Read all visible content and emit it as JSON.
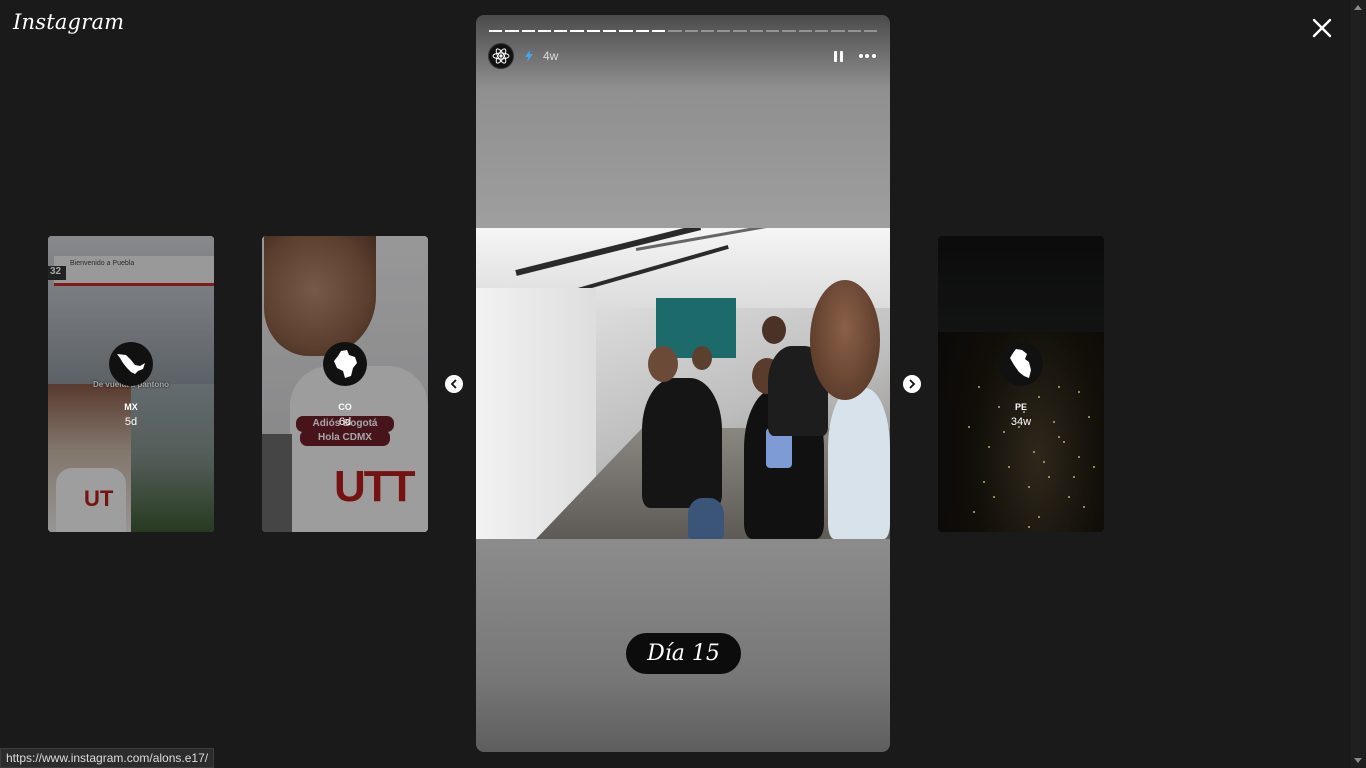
{
  "app": {
    "logo_text": "Instagram"
  },
  "viewer": {
    "close_icon": "close-icon",
    "prev_icon": "chevron-left-icon",
    "next_icon": "chevron-right-icon"
  },
  "stories_left": [
    {
      "name": "MX",
      "time": "5d",
      "caption": "De vuelta a pantono",
      "sign_text": "Bienvenido a Puebla",
      "number": "32"
    },
    {
      "name": "CO",
      "time": "6d",
      "label_line1": "Adiós Bogotá",
      "label_line2": "Hola CDMX"
    }
  ],
  "stories_right": [
    {
      "name": "PE",
      "time": "34w"
    }
  ],
  "current_story": {
    "time": "4w",
    "progress_total": 24,
    "progress_done": 11,
    "sticker_text": "Día 15",
    "pause_icon": "pause-icon",
    "more_icon": "more-options-icon"
  },
  "status_bar": {
    "url": "https://www.instagram.com/alons.e17/"
  },
  "colors": {
    "background": "#1a1a1a",
    "accent_red": "#b71c1c",
    "label_maroon": "#6d1f2a"
  }
}
